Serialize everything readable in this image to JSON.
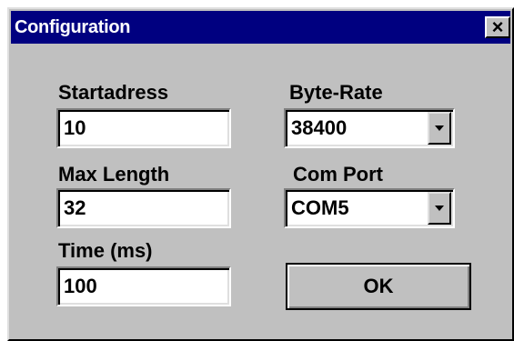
{
  "window": {
    "title": "Configuration",
    "close_label": "×"
  },
  "fields": {
    "startadress": {
      "label": "Startadress",
      "value": "10"
    },
    "max_length": {
      "label": "Max Length",
      "value": "32"
    },
    "time_ms": {
      "label": "Time (ms)",
      "value": "100"
    }
  },
  "combos": {
    "byte_rate": {
      "label": "Byte-Rate",
      "value": "38400",
      "icon": "chevron-down-icon"
    },
    "com_port": {
      "label": "Com Port",
      "value": "COM5",
      "icon": "chevron-down-icon"
    }
  },
  "buttons": {
    "ok_label": "OK"
  },
  "colors": {
    "titlebar": "#000080",
    "dialog_face": "#c0c0c0"
  }
}
